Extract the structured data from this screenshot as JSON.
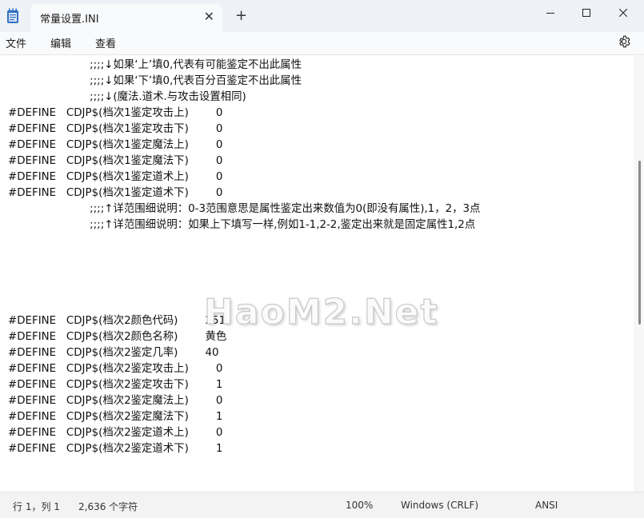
{
  "tab": {
    "title": "常量设置.INI"
  },
  "menu": [
    "文件",
    "编辑",
    "查看"
  ],
  "editor": {
    "lines": [
      {
        "indent": "                        ",
        "text": ";;;;↓如果‘上’填0,代表有可能鉴定不出此属性"
      },
      {
        "indent": "                        ",
        "text": ";;;;↓如果‘下’填0,代表百分百鉴定不出此属性"
      },
      {
        "indent": "                        ",
        "text": ";;;;↓(魔法.道术.与攻击设置相同)"
      },
      {
        "indent": "",
        "text": "#DEFINE   CDJP$(档次1鉴定攻击上)        0"
      },
      {
        "indent": "",
        "text": "#DEFINE   CDJP$(档次1鉴定攻击下)        0"
      },
      {
        "indent": "",
        "text": "#DEFINE   CDJP$(档次1鉴定魔法上)        0"
      },
      {
        "indent": "",
        "text": "#DEFINE   CDJP$(档次1鉴定魔法下)        0"
      },
      {
        "indent": "",
        "text": "#DEFINE   CDJP$(档次1鉴定道术上)        0"
      },
      {
        "indent": "",
        "text": "#DEFINE   CDJP$(档次1鉴定道术下)        0"
      },
      {
        "indent": "                        ",
        "text": ";;;;↑详范围细说明：0-3范围意思是属性鉴定出来数值为0(即没有属性),1，2，3点"
      },
      {
        "indent": "                        ",
        "text": ";;;;↑详范围细说明：如果上下填写一样,例如1-1,2-2,鉴定出来就是固定属性1,2点"
      },
      {
        "indent": "",
        "text": ""
      },
      {
        "indent": "",
        "text": ""
      },
      {
        "indent": "",
        "text": ""
      },
      {
        "indent": "",
        "text": ""
      },
      {
        "indent": "",
        "text": ""
      },
      {
        "indent": "",
        "text": "#DEFINE   CDJP$(档次2颜色代码)        251"
      },
      {
        "indent": "",
        "text": "#DEFINE   CDJP$(档次2颜色名称)        黄色"
      },
      {
        "indent": "",
        "text": "#DEFINE   CDJP$(档次2鉴定几率)        40"
      },
      {
        "indent": "",
        "text": "#DEFINE   CDJP$(档次2鉴定攻击上)        0"
      },
      {
        "indent": "",
        "text": "#DEFINE   CDJP$(档次2鉴定攻击下)        1"
      },
      {
        "indent": "",
        "text": "#DEFINE   CDJP$(档次2鉴定魔法上)        0"
      },
      {
        "indent": "",
        "text": "#DEFINE   CDJP$(档次2鉴定魔法下)        1"
      },
      {
        "indent": "",
        "text": "#DEFINE   CDJP$(档次2鉴定道术上)        0"
      },
      {
        "indent": "",
        "text": "#DEFINE   CDJP$(档次2鉴定道术下)        1"
      }
    ]
  },
  "watermark": "HaoM2.Net",
  "status": {
    "position": "行 1，列 1",
    "chars": "2,636 个字符",
    "zoom": "100%",
    "line_ending": "Windows (CRLF)",
    "encoding": "ANSI"
  },
  "icons": {
    "app": "notepad-icon",
    "close_tab": "close-icon",
    "new_tab": "plus-icon",
    "minimize": "minimize-icon",
    "maximize": "maximize-icon",
    "close_window": "close-icon",
    "settings": "gear-icon"
  }
}
